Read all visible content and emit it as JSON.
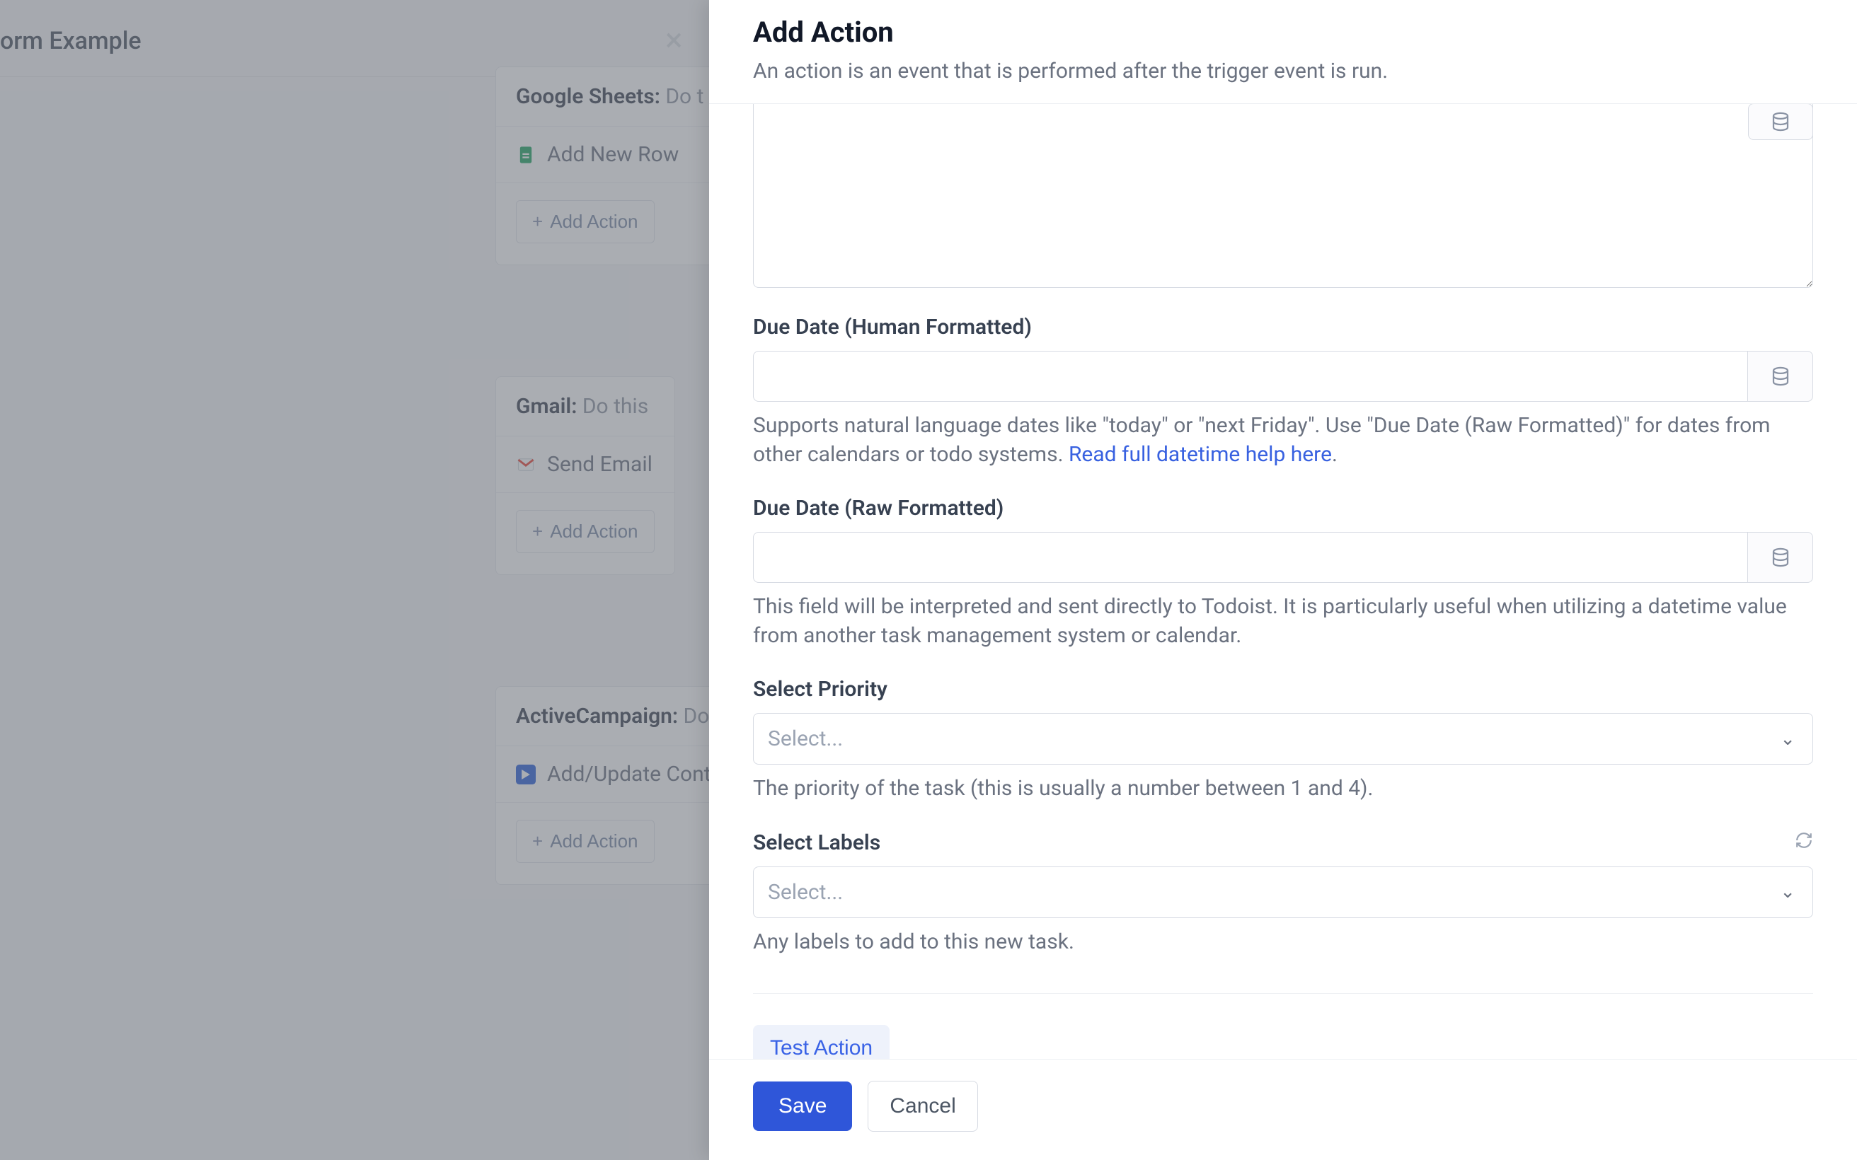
{
  "bg": {
    "header_fragment": "orm Example",
    "cards": [
      {
        "app": "Google Sheets:",
        "sub": "Do t",
        "row_icon": "sheets",
        "row_label": "Add New Row",
        "add_label": "Add Action"
      },
      {
        "app": "Gmail:",
        "sub": "Do this",
        "row_icon": "gmail",
        "row_label": "Send Email",
        "add_label": "Add Action"
      },
      {
        "app": "ActiveCampaign:",
        "sub": "Do",
        "row_icon": "ac",
        "row_label": "Add/Update Conta",
        "add_label": "Add Action"
      }
    ]
  },
  "panel": {
    "title": "Add Action",
    "subtitle": "An action is an event that is performed after the trigger event is run.",
    "fields": {
      "due_human": {
        "label": "Due Date (Human Formatted)",
        "helper_pre": "Supports natural language dates like \"today\" or \"next Friday\". Use \"Due Date (Raw Formatted)\" for dates from other calendars or todo systems. ",
        "helper_link": "Read full datetime help here",
        "helper_suffix": "."
      },
      "due_raw": {
        "label": "Due Date (Raw Formatted)",
        "helper": "This field will be interpreted and sent directly to Todoist. It is particularly useful when utilizing a datetime value from another task management system or calendar."
      },
      "priority": {
        "label": "Select Priority",
        "placeholder": "Select...",
        "helper": "The priority of the task (this is usually a number between 1 and 4)."
      },
      "labels": {
        "label": "Select Labels",
        "placeholder": "Select...",
        "helper": "Any labels to add to this new task."
      }
    },
    "test_label": "Test Action",
    "save_label": "Save",
    "cancel_label": "Cancel"
  }
}
